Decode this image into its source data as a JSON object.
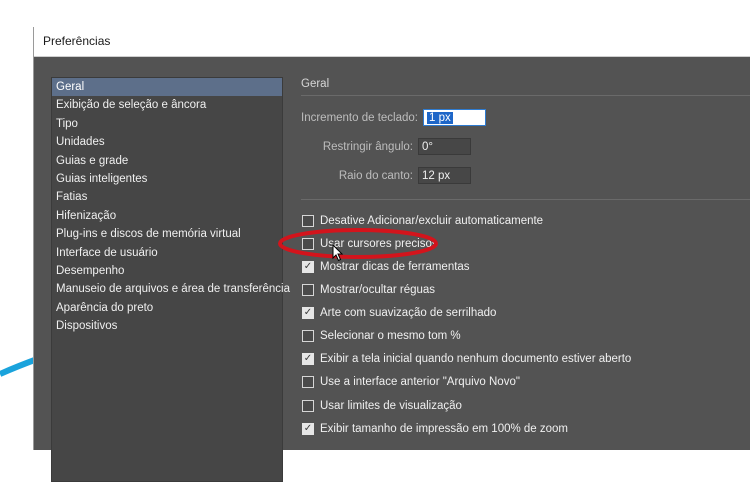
{
  "window": {
    "title": "Preferências"
  },
  "sidebar": {
    "items": [
      {
        "label": "Geral",
        "selected": true
      },
      {
        "label": "Exibição de seleção e âncora"
      },
      {
        "label": "Tipo"
      },
      {
        "label": "Unidades"
      },
      {
        "label": "Guias e grade"
      },
      {
        "label": "Guias inteligentes"
      },
      {
        "label": "Fatias"
      },
      {
        "label": "Hifenização"
      },
      {
        "label": "Plug-ins e discos de memória virtual"
      },
      {
        "label": "Interface de usuário"
      },
      {
        "label": "Desempenho"
      },
      {
        "label": "Manuseio de arquivos e área de transferência"
      },
      {
        "label": "Aparência do preto"
      },
      {
        "label": "Dispositivos"
      }
    ]
  },
  "panel": {
    "title": "Geral",
    "fields": {
      "keyboard_increment": {
        "label": "Incremento de teclado:",
        "value": "1 px"
      },
      "constrain_angle": {
        "label": "Restringir ângulo:",
        "value": "0°"
      },
      "corner_radius": {
        "label": "Raio do canto:",
        "value": "12 px"
      }
    },
    "checkboxes": [
      {
        "label": "Desative Adicionar/excluir automaticamente",
        "checked": false
      },
      {
        "label": "Usar cursores precisos",
        "checked": false
      },
      {
        "label": "Mostrar dicas de ferramentas",
        "checked": true
      },
      {
        "label": "Mostrar/ocultar réguas",
        "checked": false
      },
      {
        "label": "Arte com suavização de serrilhado",
        "checked": true
      },
      {
        "label": "Selecionar o mesmo tom %",
        "checked": false
      },
      {
        "label": "Exibir a tela inicial quando nenhum documento estiver aberto",
        "checked": true
      },
      {
        "label": "Use a interface anterior \"Arquivo Novo\"",
        "checked": false
      },
      {
        "label": "Usar limites de visualização",
        "checked": false
      },
      {
        "label": "Exibir tamanho de impressão em 100% de zoom",
        "checked": true
      }
    ]
  },
  "colors": {
    "highlight_ellipse": "#d3141c",
    "background_arc": "#1aa3dc",
    "selection": "#5d6f8a"
  }
}
